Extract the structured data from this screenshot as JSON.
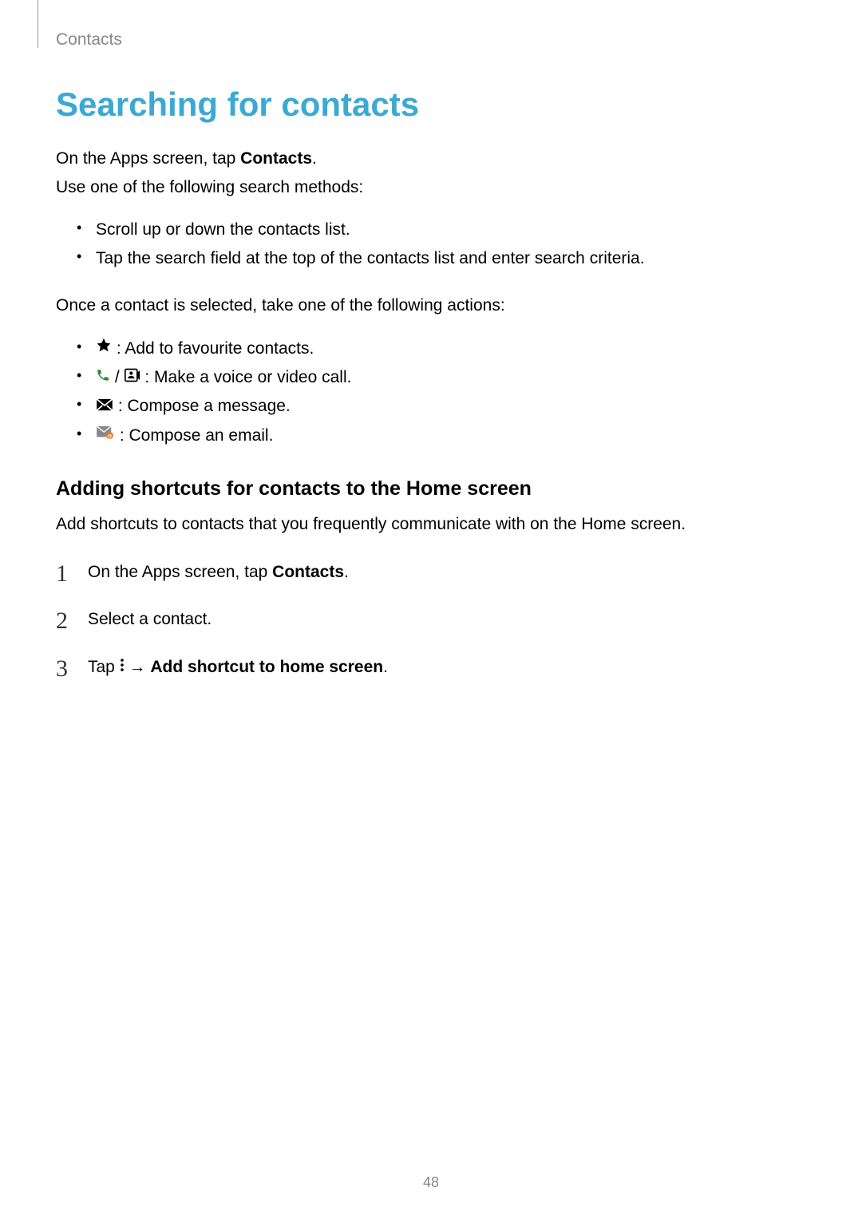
{
  "breadcrumb": "Contacts",
  "heading": "Searching for contacts",
  "intro_1a": "On the Apps screen, tap ",
  "intro_1b": "Contacts",
  "intro_1c": ".",
  "intro_2": "Use one of the following search methods:",
  "bullets_a": [
    "Scroll up or down the contacts list.",
    "Tap the search field at the top of the contacts list and enter search criteria."
  ],
  "intro_3": "Once a contact is selected, take one of the following actions:",
  "action_items": {
    "fav": " : Add to favourite contacts.",
    "call_sep": " / ",
    "call": " : Make a voice or video call.",
    "msg": " : Compose a message.",
    "email": " : Compose an email."
  },
  "subheading": "Adding shortcuts for contacts to the Home screen",
  "sub_intro": "Add shortcuts to contacts that you frequently communicate with on the Home screen.",
  "steps": {
    "s1a": "On the Apps screen, tap ",
    "s1b": "Contacts",
    "s1c": ".",
    "s2": "Select a contact.",
    "s3a": "Tap ",
    "s3b": " → ",
    "s3c": "Add shortcut to home screen",
    "s3d": "."
  },
  "step_nums": {
    "n1": "1",
    "n2": "2",
    "n3": "3"
  },
  "pagenum": "48"
}
